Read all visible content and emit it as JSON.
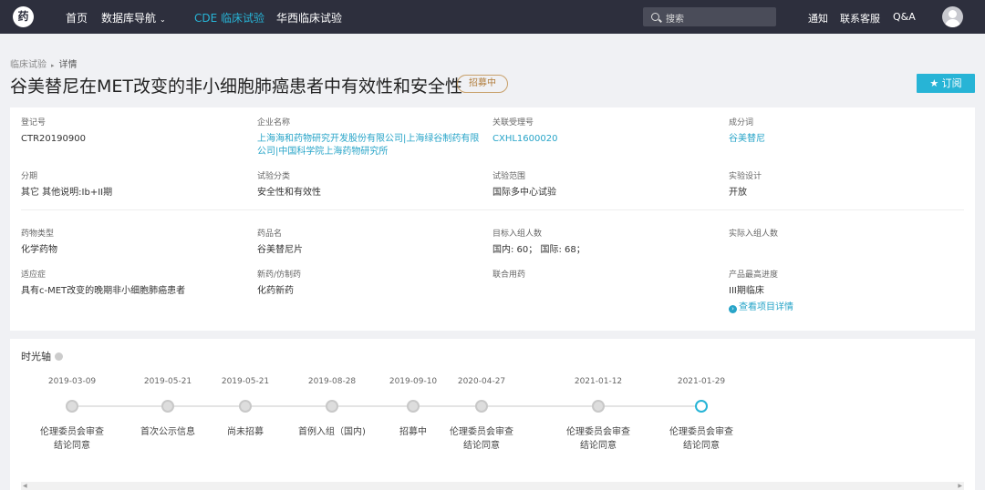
{
  "nav": {
    "logo": "药",
    "items": [
      {
        "label": "首页"
      },
      {
        "label": "数据库导航"
      },
      {
        "label": "CDE 临床试验"
      },
      {
        "label": "华西临床试验"
      }
    ],
    "dropdown_glyph": "⌄",
    "search_placeholder": "搜索",
    "right_links": [
      {
        "label": "通知"
      },
      {
        "label": "联系客服"
      },
      {
        "label": "Q&A"
      }
    ]
  },
  "breadcrumb": {
    "parent": "临床试验",
    "separator": "▸",
    "current": "详情"
  },
  "title": "谷美替尼在MET改变的非小细胞肺癌患者中有效性和安全性",
  "status_badge": "招募中",
  "subscribe_label": "★ 订阅",
  "fields": {
    "reg_no": {
      "label": "登记号",
      "value": "CTR20190900"
    },
    "company": {
      "label": "企业名称",
      "value": "上海海和药物研究开发股份有限公司|上海绿谷制药有限公司|中国科学院上海药物研究所"
    },
    "related_no": {
      "label": "关联受理号",
      "value": "CXHL1600020"
    },
    "ingredient": {
      "label": "成分词",
      "value": "谷美替尼"
    },
    "phase": {
      "label": "分期",
      "value": "其它 其他说明:Ib+II期"
    },
    "category": {
      "label": "试验分类",
      "value": "安全性和有效性"
    },
    "scope": {
      "label": "试验范围",
      "value": "国际多中心试验"
    },
    "design": {
      "label": "实验设计",
      "value": "开放"
    },
    "drug_type": {
      "label": "药物类型",
      "value": "化学药物"
    },
    "drug_name": {
      "label": "药品名",
      "value": "谷美替尼片"
    },
    "target_enroll": {
      "label": "目标入组人数",
      "value": "国内: 60； 国际: 68；"
    },
    "actual_enroll": {
      "label": "实际入组人数",
      "value": ""
    },
    "indication": {
      "label": "适应症",
      "value": "具有c-MET改变的晚期非小细胞肺癌患者"
    },
    "new_drug": {
      "label": "新药/仿制药",
      "value": "化药新药"
    },
    "combo": {
      "label": "联合用药",
      "value": ""
    },
    "progress": {
      "label": "产品最高进度",
      "value": "III期临床",
      "link": "查看项目详情",
      "link_glyph": "›"
    }
  },
  "timeline": {
    "title": "时光轴",
    "events": [
      {
        "date": "2019-03-09",
        "label": "伦理委员会审查结论同意",
        "current": false
      },
      {
        "date": "2019-05-21",
        "label": "首次公示信息",
        "current": false
      },
      {
        "date": "2019-05-21",
        "label": "尚未招募",
        "current": false
      },
      {
        "date": "2019-08-28",
        "label": "首例入组（国内)",
        "current": false
      },
      {
        "date": "2019-09-10",
        "label": "招募中",
        "current": false
      },
      {
        "date": "2020-04-27",
        "label": "伦理委员会审查结论同意",
        "current": false
      },
      {
        "date": "2021-01-12",
        "label": "伦理委员会审查结论同意",
        "current": false
      },
      {
        "date": "2021-01-29",
        "label": "伦理委员会审查结论同意",
        "current": true
      }
    ]
  },
  "scroll_arrows": {
    "left": "◀",
    "right": "▶"
  },
  "colors": {
    "accent": "#27b4d6",
    "nav_bg": "#2d2f3d",
    "badge": "#b07c3a"
  }
}
